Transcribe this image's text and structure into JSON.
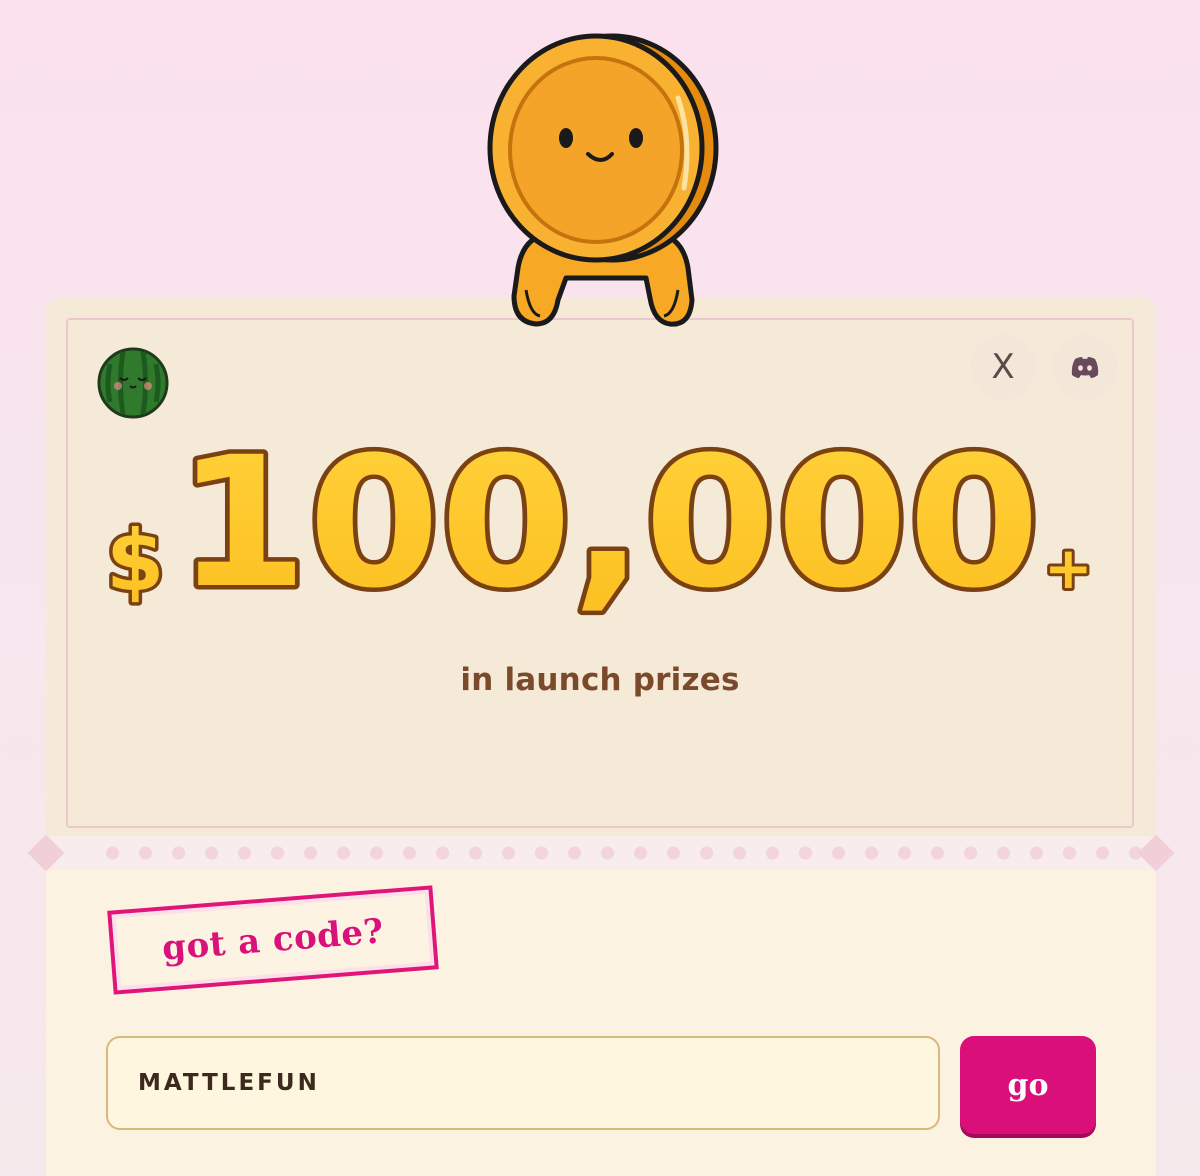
{
  "hero": {
    "amount": "100,000",
    "currency_symbol": "$",
    "plus_symbol": "+",
    "subtitle": "in launch prizes"
  },
  "social": {
    "x_label": "X",
    "discord_icon": "discord-icon"
  },
  "promo": {
    "tag_label": "got a code?",
    "code_value": "MATTLEFUN",
    "submit_label": "go"
  },
  "colors": {
    "accent_pink": "#db0f79",
    "prize_yellow": "#ffc928",
    "prize_outline": "#7a4212",
    "card_top": "#f5ead8",
    "card_bottom": "#fbf2e1"
  }
}
